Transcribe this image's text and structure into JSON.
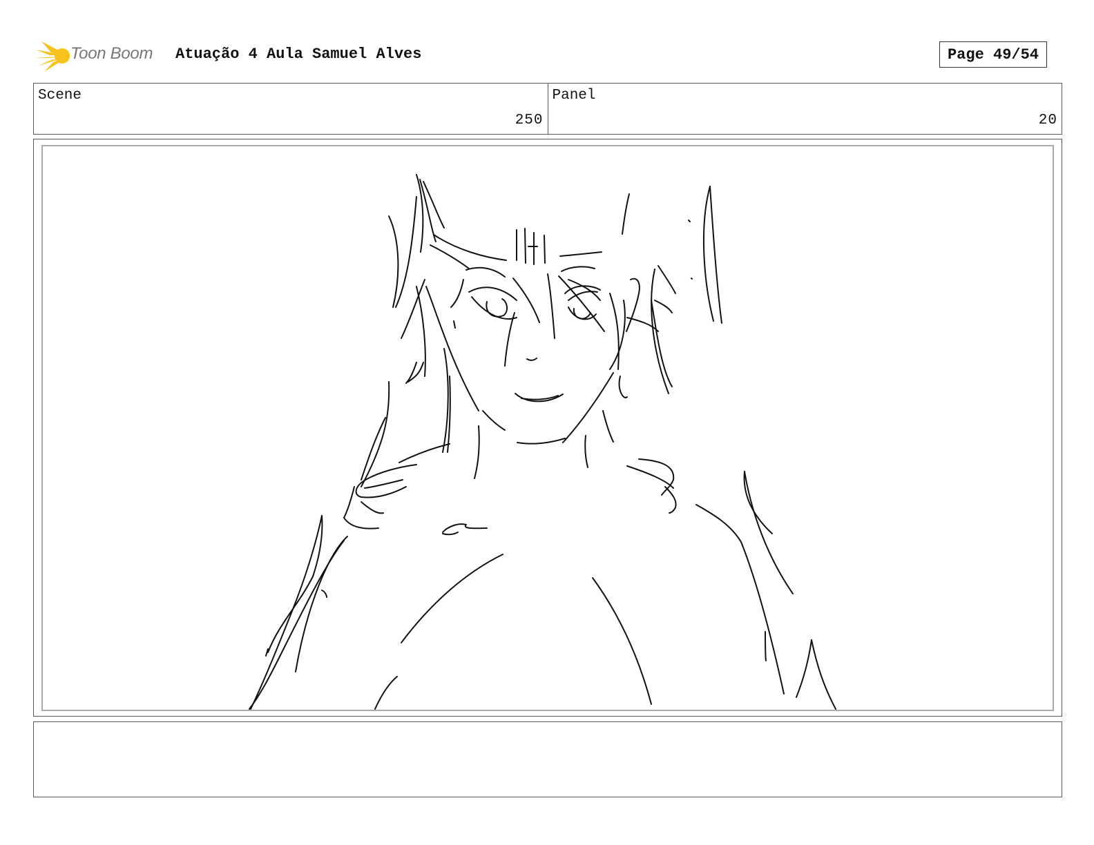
{
  "header": {
    "logo_text": "Toon Boom",
    "project_title": "Atuação 4 Aula Samuel Alves",
    "page_label": "Page 49/54"
  },
  "scene": {
    "label": "Scene",
    "value": "250"
  },
  "panel": {
    "label": "Panel",
    "value": "20"
  },
  "notes": {
    "text": ""
  },
  "colors": {
    "logo_burst": "#f7c21b",
    "logo_text": "#777777",
    "border": "#555555",
    "panel_inner_border": "#aaaaaa"
  }
}
